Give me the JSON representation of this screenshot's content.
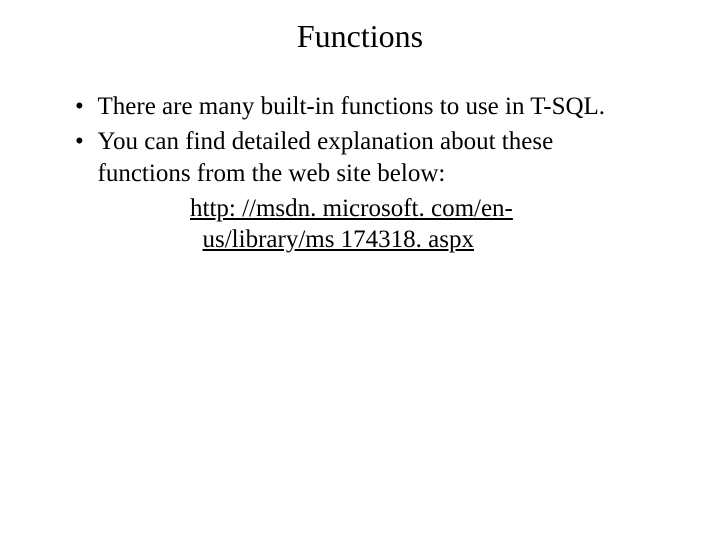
{
  "slide": {
    "title": "Functions",
    "bullets": [
      "There are many built-in functions to use in T-SQL.",
      "You can find detailed explanation about these functions from the web site below:"
    ],
    "link_line1": "http: //msdn. microsoft. com/en-",
    "link_line2": "us/library/ms 174318. aspx"
  }
}
